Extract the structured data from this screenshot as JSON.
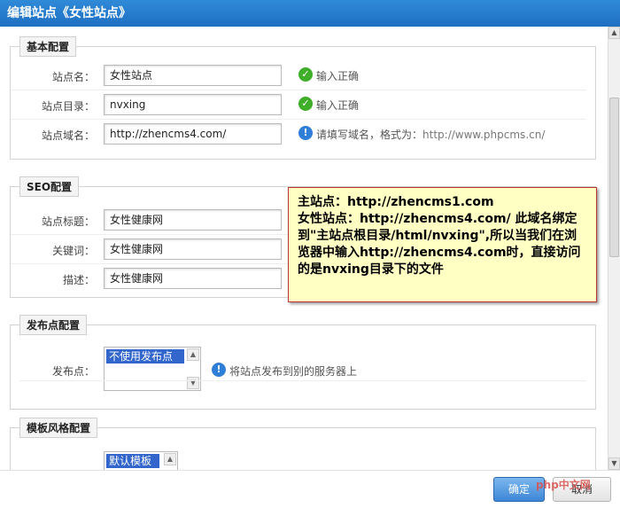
{
  "dialog": {
    "title": "编辑站点《女性站点》",
    "close_symbol": "✕"
  },
  "basic": {
    "legend": "基本配置",
    "rows": [
      {
        "label": "站点名：",
        "value": "女性站点",
        "hint": "输入正确",
        "hint_type": "ok"
      },
      {
        "label": "站点目录：",
        "value": "nvxing",
        "hint": "输入正确",
        "hint_type": "ok"
      },
      {
        "label": "站点域名：",
        "value": "http://zhencms4.com/",
        "hint": "请填写域名，格式为：",
        "hint_extra": "http://www.phpcms.cn/",
        "hint_type": "info"
      }
    ]
  },
  "seo": {
    "legend": "SEO配置",
    "rows": [
      {
        "label": "站点标题：",
        "value": "女性健康网"
      },
      {
        "label": "关键词：",
        "value": "女性健康网"
      },
      {
        "label": "描述：",
        "value": "女性健康网"
      }
    ]
  },
  "publish": {
    "legend": "发布点配置",
    "label": "发布点：",
    "selected_option": "不使用发布点",
    "hint": "将站点发布到别的服务器上"
  },
  "template": {
    "legend": "模板风格配置",
    "selected_option": "默认模板"
  },
  "note": {
    "text": "主站点：http://zhencms1.com\n女性站点：http://zhencms4.com/   此域名绑定到\"主站点根目录/html/nvxing\",所以当我们在浏览器中输入http://zhencms4.com时，直接访问的是nvxing目录下的文件"
  },
  "footer": {
    "ok_label": "确定",
    "cancel_label": "取消",
    "watermark": "php中文网"
  },
  "colors": {
    "titlebar": "#1f6fc2",
    "ok_icon": "#3fae29",
    "info_icon": "#2f7ed8",
    "note_bg": "#ffffc4"
  },
  "icons": {
    "ok": "check-circle-icon",
    "info": "info-circle-icon"
  }
}
